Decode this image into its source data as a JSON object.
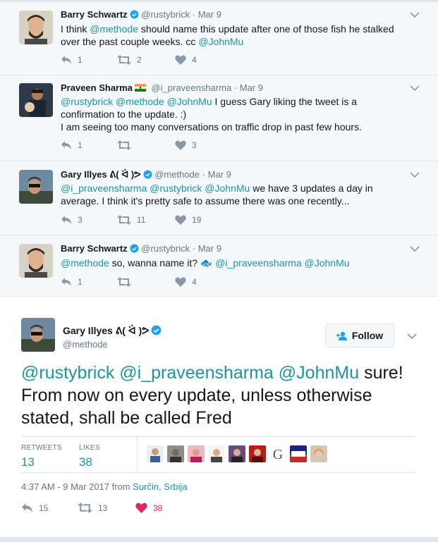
{
  "replies": [
    {
      "name": "Barry Schwartz",
      "verified": true,
      "handle": "@rustybrick",
      "time": "Mar 9",
      "segments": [
        {
          "t": "I think ",
          "m": false
        },
        {
          "t": "@methode",
          "m": true
        },
        {
          "t": " should name this update after one of those fish he stalked over the past couple weeks.  cc ",
          "m": false
        },
        {
          "t": "@JohnMu",
          "m": true
        }
      ],
      "reply_count": "1",
      "retweet_count": "2",
      "like_count": "4"
    },
    {
      "name": "Praveen Sharma",
      "flag": "india-flag",
      "handle": "@i_praveensharma",
      "time": "Mar 9",
      "segments": [
        {
          "t": "@rustybrick",
          "m": true
        },
        {
          "t": " ",
          "m": false
        },
        {
          "t": "@methode",
          "m": true
        },
        {
          "t": " ",
          "m": false
        },
        {
          "t": "@JohnMu",
          "m": true
        },
        {
          "t": " I guess Gary liking the tweet is a confirmation to the update. :)",
          "m": false
        }
      ],
      "segments2": [
        {
          "t": "I am seeing too many conversations on traffic drop in past few hours.",
          "m": false
        }
      ],
      "reply_count": "1",
      "retweet_count": "",
      "like_count": "3"
    },
    {
      "name": "Gary Illyes ᕕ( ᐛ )ᕗ",
      "verified": true,
      "handle": "@methode",
      "time": "Mar 9",
      "segments": [
        {
          "t": "@i_praveensharma",
          "m": true
        },
        {
          "t": " ",
          "m": false
        },
        {
          "t": "@rustybrick",
          "m": true
        },
        {
          "t": " ",
          "m": false
        },
        {
          "t": "@JohnMu",
          "m": true
        },
        {
          "t": " we have 3 updates a day in average. I think it's pretty safe to assume there was one recently...",
          "m": false
        }
      ],
      "reply_count": "3",
      "retweet_count": "11",
      "like_count": "19"
    },
    {
      "name": "Barry Schwartz",
      "verified": true,
      "handle": "@rustybrick",
      "time": "Mar 9",
      "segments": [
        {
          "t": "@methode",
          "m": true
        },
        {
          "t": " so, wanna name it? ",
          "m": false
        },
        {
          "t": "🐟",
          "m": true
        },
        {
          "t": "  ",
          "m": false
        },
        {
          "t": "@i_praveensharma",
          "m": true
        },
        {
          "t": " ",
          "m": false
        },
        {
          "t": "@JohnMu",
          "m": true
        }
      ],
      "reply_count": "1",
      "retweet_count": "",
      "like_count": "4"
    }
  ],
  "main_tweet": {
    "name": "Gary Illyes ᕕ( ᐛ )ᕗ",
    "handle": "@methode",
    "follow_label": "Follow",
    "segments": [
      {
        "t": "@rustybrick",
        "m": true
      },
      {
        "t": " ",
        "m": false
      },
      {
        "t": "@i_praveensharma",
        "m": true
      },
      {
        "t": " ",
        "m": false
      },
      {
        "t": "@JohnMu",
        "m": true
      },
      {
        "t": " sure! From now on every update, unless otherwise stated, shall be called Fred",
        "m": false
      }
    ],
    "retweets_label": "RETWEETS",
    "retweets_count": "13",
    "likes_label": "LIKES",
    "likes_count": "38",
    "timestamp": "4:37 AM - 9 Mar 2017 from ",
    "location": "Surčin, Srbija",
    "reply_count": "15",
    "retweet_count": "13",
    "like_count": "38"
  },
  "colors": {
    "accent": "#1b95a0",
    "verified": "#1da1f2",
    "liked": "#e0245e",
    "muted": "#657786"
  }
}
